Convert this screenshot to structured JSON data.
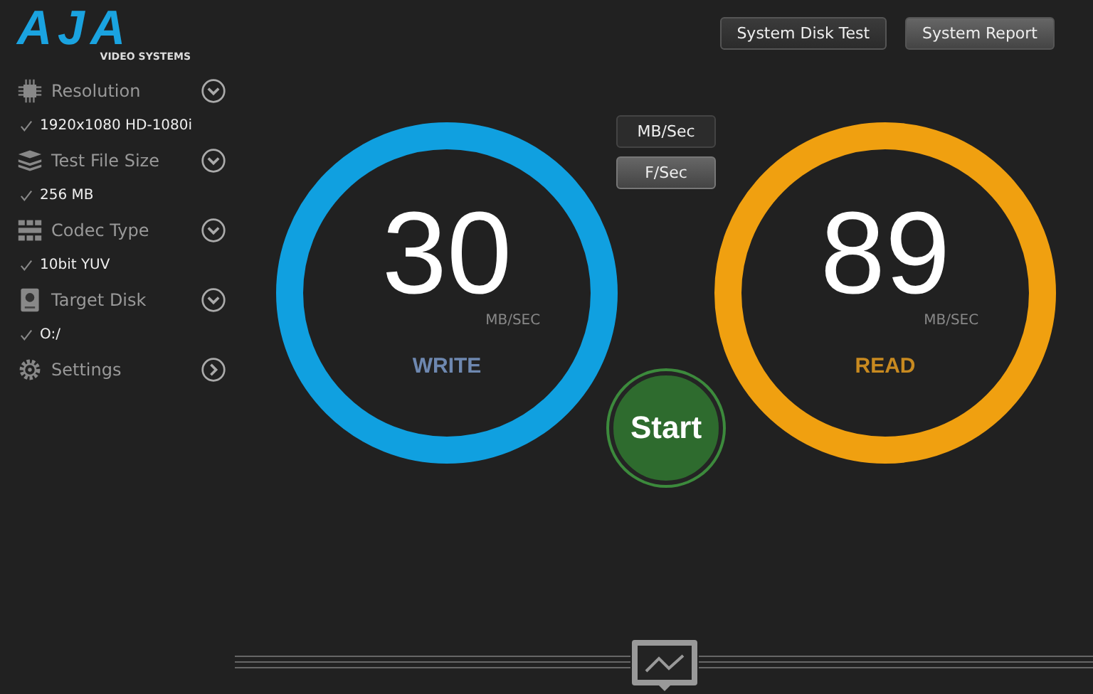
{
  "logo": {
    "wordmark": "AJA",
    "tagline": "VIDEO SYSTEMS"
  },
  "sidebar": {
    "items": [
      {
        "kind": "dropdown",
        "label": "Resolution",
        "value": "1920x1080 HD-1080i"
      },
      {
        "kind": "dropdown",
        "label": "Test File Size",
        "value": "256 MB"
      },
      {
        "kind": "dropdown",
        "label": "Codec Type",
        "value": "10bit YUV"
      },
      {
        "kind": "dropdown",
        "label": "Target Disk",
        "value": "O:/"
      },
      {
        "kind": "link",
        "label": "Settings"
      }
    ]
  },
  "top_buttons": [
    "System Disk Test",
    "System Report"
  ],
  "units": [
    {
      "label": "MB/Sec",
      "selected": false
    },
    {
      "label": "F/Sec",
      "selected": true
    }
  ],
  "gauges": [
    {
      "value": "30",
      "unit": "MB/SEC",
      "label": "WRITE",
      "color": "#10a0e0"
    },
    {
      "value": "89",
      "unit": "MB/SEC",
      "label": "READ",
      "color": "#f0a010"
    }
  ],
  "start_button": "Start"
}
